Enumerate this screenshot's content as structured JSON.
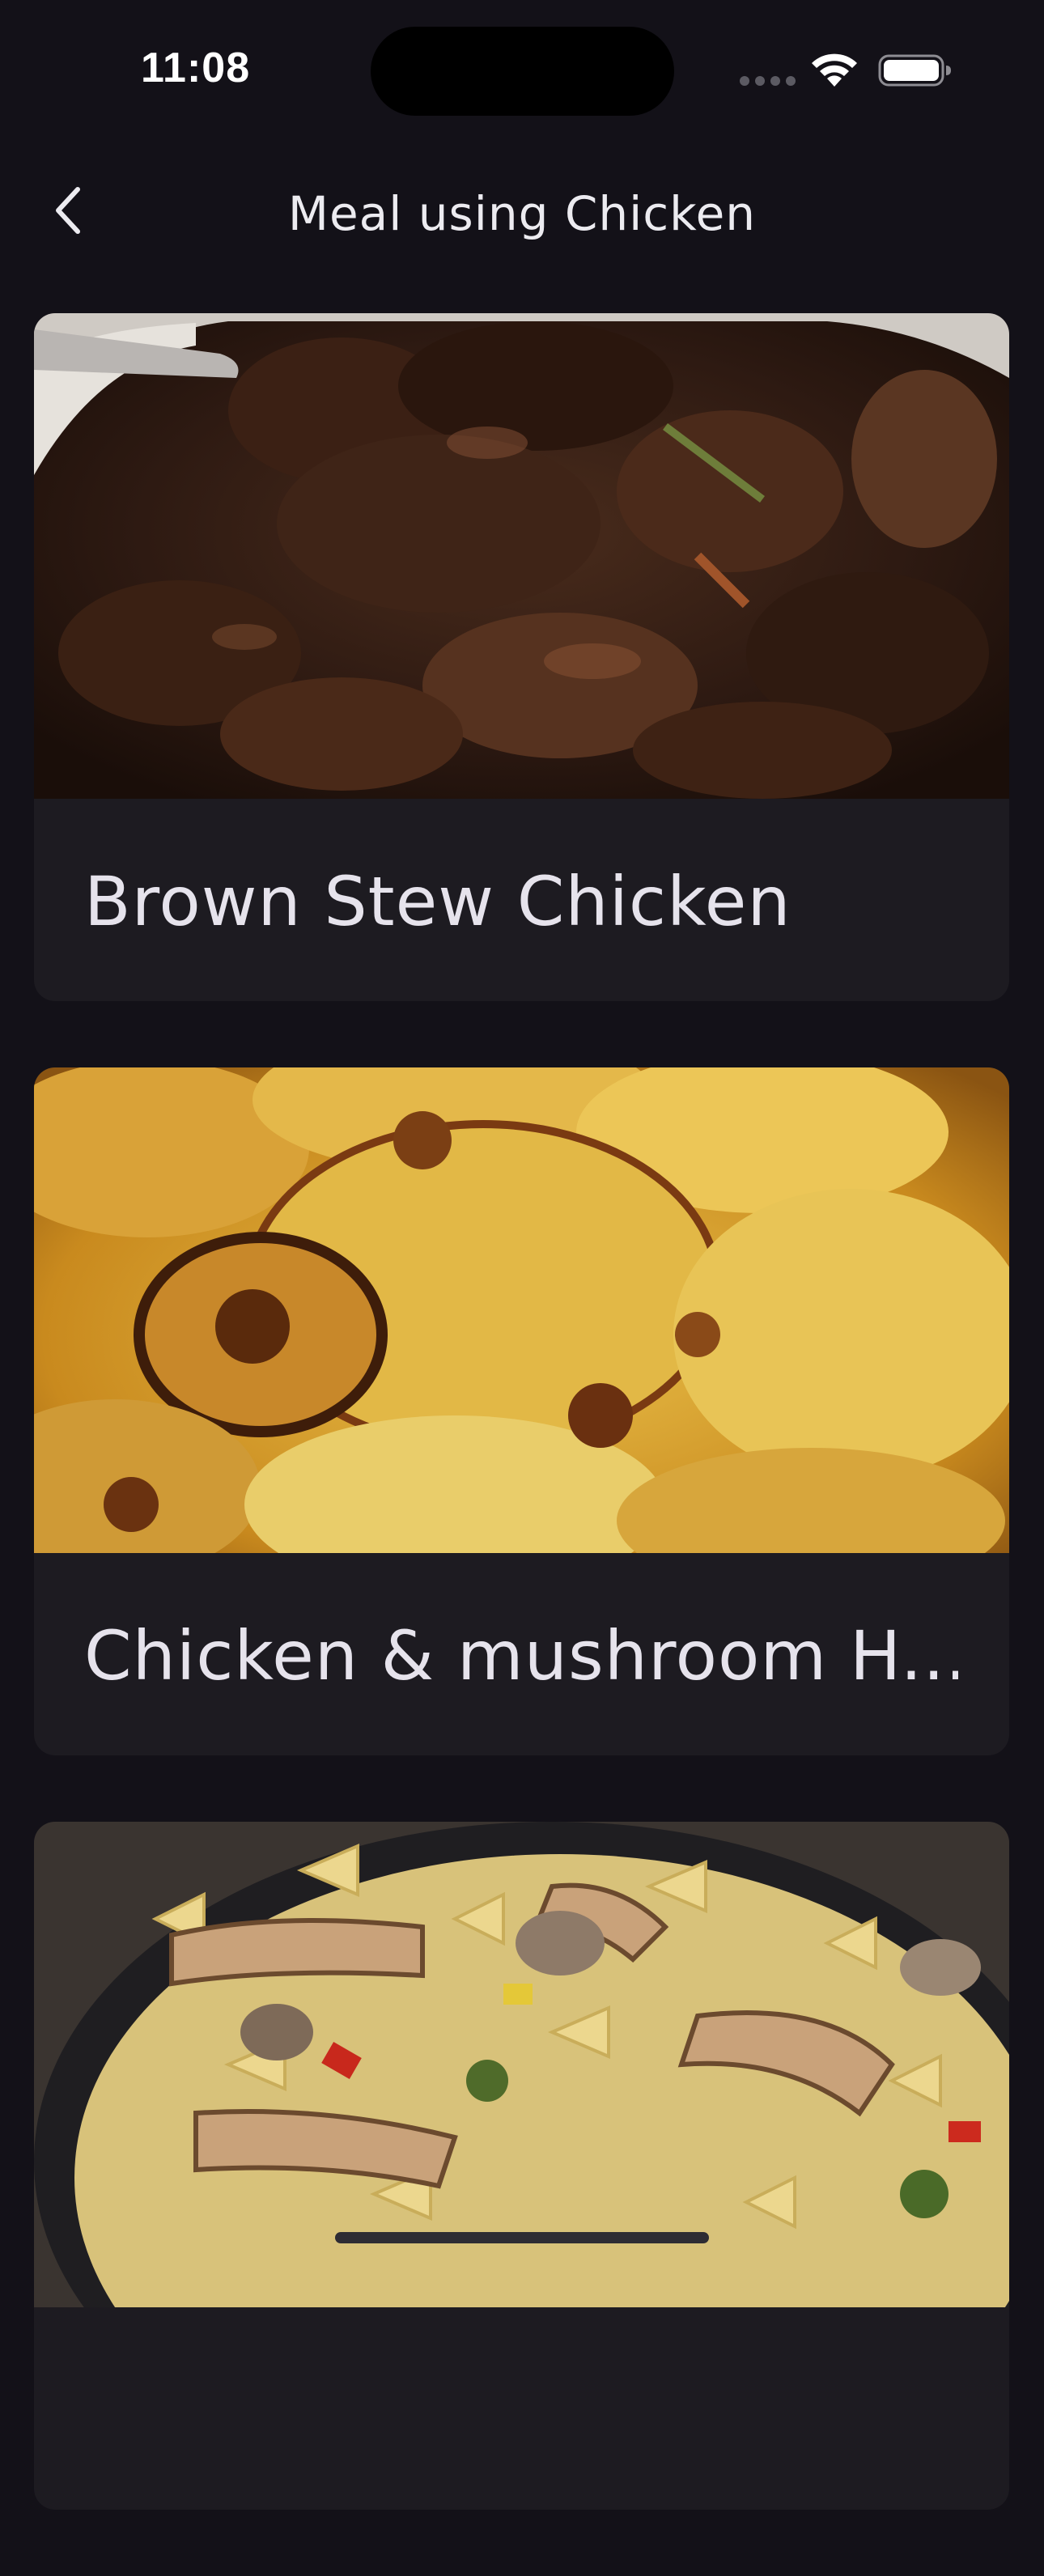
{
  "status_bar": {
    "time": "11:08",
    "icons": [
      "cellular-signal-icon",
      "wifi-icon",
      "battery-icon"
    ]
  },
  "header": {
    "back_icon": "chevron-left-icon",
    "title": "Meal using Chicken"
  },
  "meals": [
    {
      "name": "Brown Stew Chicken",
      "image": "brown-stew-chicken-photo"
    },
    {
      "name": "Chicken & mushroom H...",
      "image": "potato-bake-photo"
    },
    {
      "name": "",
      "image": "chicken-bowtie-pasta-photo"
    }
  ],
  "colors": {
    "background": "#131118",
    "card": "#1d1b21",
    "text": "#e6e3ec"
  }
}
